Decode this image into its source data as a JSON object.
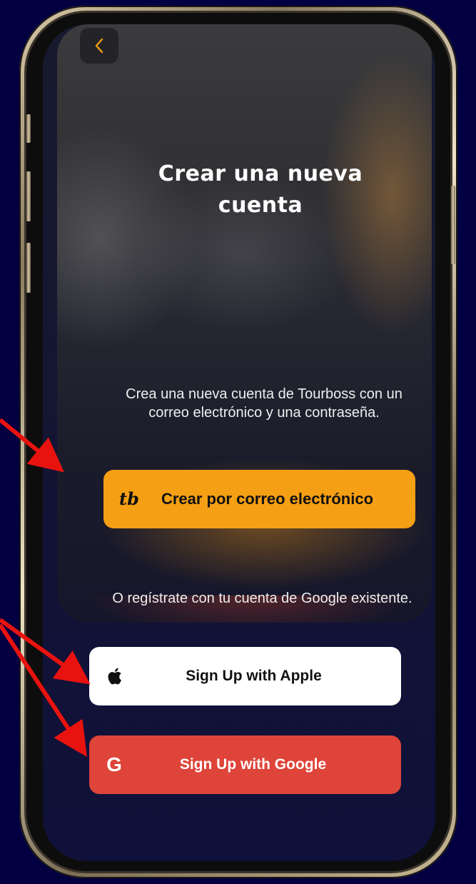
{
  "colors": {
    "page_background": "#020040",
    "accent_orange": "#f59f14",
    "google_red": "#de4439",
    "apple_white": "#ffffff",
    "back_arrow": "#f59f14",
    "annotation_arrow": "#e8130f"
  },
  "header": {
    "back_icon": "chevron-left-icon"
  },
  "main": {
    "title": "Crear una nueva cuenta",
    "subtitle": "Crea una nueva cuenta de Tourboss con un correo electrónico y una contraseña.",
    "email_button": {
      "icon": "tourboss-logo-icon",
      "logo_text": "tb",
      "label": "Crear por correo electrónico"
    },
    "google_prompt": "O regístrate con tu cuenta de Google existente."
  },
  "social": {
    "apple": {
      "icon": "apple-icon",
      "label": "Sign Up with Apple"
    },
    "google": {
      "icon": "google-g-icon",
      "icon_glyph": "G",
      "label": "Sign Up with Google"
    }
  }
}
